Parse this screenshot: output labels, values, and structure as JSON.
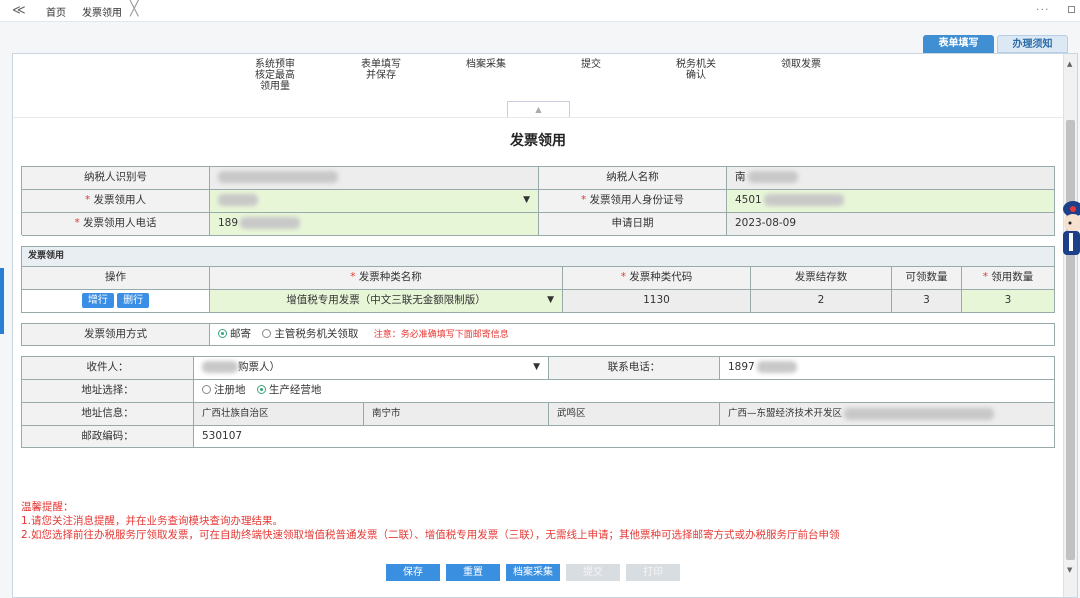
{
  "topbar": {
    "back": "≪",
    "tabs": [
      "首页",
      "发票领用"
    ],
    "close": "╳",
    "more": "···"
  },
  "tabs": {
    "form": "表单填写",
    "guide": "办理须知"
  },
  "steps": [
    {
      "lines": [
        "系统预审",
        "核定最高",
        "领用量"
      ]
    },
    {
      "lines": [
        "表单填写",
        "并保存"
      ]
    },
    {
      "lines": [
        "档案采集"
      ]
    },
    {
      "lines": [
        "提交"
      ]
    },
    {
      "lines": [
        "税务机关",
        "确认"
      ]
    },
    {
      "lines": [
        "领取发票"
      ]
    }
  ],
  "collapse_icon": "▲",
  "title": "发票领用",
  "info": {
    "tax_id_label": "纳税人识别号",
    "tax_name_label": "纳税人名称",
    "tax_name_value": "南",
    "receiver_label": "发票领用人",
    "id_label": "发票领用人身份证号",
    "id_value": "4501",
    "phone_label": "发票领用人电话",
    "phone_value": "189",
    "date_label": "申请日期",
    "date_value": "2023-08-09",
    "required_mark": "*"
  },
  "section": {
    "title": "发票领用"
  },
  "grid": {
    "headers": [
      "操作",
      "发票种类名称",
      "发票种类代码",
      "发票结存数",
      "可领数量",
      "领用数量"
    ],
    "add_label": "增行",
    "del_label": "删行",
    "row": {
      "name": "增值税专用发票（中文三联无金额限制版）",
      "code": "1130",
      "stock": "2",
      "available": "3",
      "qty": "3"
    }
  },
  "method": {
    "label": "发票领用方式",
    "opt1": "邮寄",
    "opt2": "主管税务机关领取",
    "note": "注意：务必准确填写下面邮寄信息"
  },
  "mail": {
    "recipient_label": "收件人：",
    "recipient_value": "购票人）",
    "phone_label": "联系电话：",
    "phone_value": "1897",
    "addr_choice_label": "地址选择：",
    "addr_opt1": "注册地",
    "addr_opt2": "生产经营地",
    "addr_info_label": "地址信息：",
    "province": "广西壮族自治区",
    "city": "南宁市",
    "district": "武鸣区",
    "detail": "广西—东盟经济技术开发区",
    "zip_label": "邮政编码：",
    "zip_value": "530107"
  },
  "tips": {
    "title": "温馨提醒：",
    "line1": "1.请您关注消息提醒，并在业务查询模块查询办理结果。",
    "line2": "2.如您选择前往办税服务厅领取发票，可在自助终端快速领取增值税普通发票（二联）、增值税专用发票（三联），无需线上申请；其他票种可选择邮寄方式或办税服务厅前台申领"
  },
  "buttons": {
    "save": "保存",
    "reset": "重置",
    "archive": "档案采集",
    "submit": "提交",
    "print": "打印"
  },
  "colors": {
    "accent": "#3b8fe0",
    "required": "#e53935",
    "field_green": "#e8f6d8"
  }
}
